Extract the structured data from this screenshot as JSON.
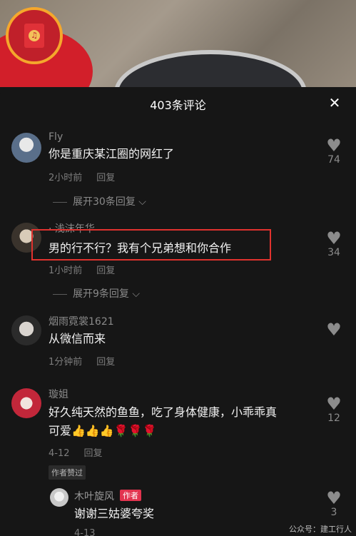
{
  "header": {
    "title": "403条评论",
    "close_icon": "close-icon"
  },
  "comments": [
    {
      "name": "Fly",
      "text": "你是重庆某江圈的网红了",
      "time": "2小时前",
      "reply": "回复",
      "expand": "展开30条回复",
      "likes": "74"
    },
    {
      "name": "· 浅沫年华",
      "text": "男的行不行？我有个兄弟想和你合作",
      "time": "1小时前",
      "reply": "回复",
      "expand": "展开9条回复",
      "likes": "34"
    },
    {
      "name": "烟雨霓裳1621",
      "text": "从微信而来",
      "time": "1分钟前",
      "reply": "回复",
      "likes": ""
    },
    {
      "name": "璇姐",
      "text_line1": "好久纯天然的鱼鱼，吃了身体健康，小乖乖真",
      "text_line2": "可爱👍👍👍🌹🌹🌹",
      "time": "4-12",
      "reply": "回复",
      "badge": "作者赞过",
      "likes": "12"
    }
  ],
  "sub_reply": {
    "name": "木叶旋风",
    "author_tag": "作者",
    "text": "谢谢三姑婆夸奖",
    "time": "4-13",
    "likes": "3"
  },
  "watermark": "公众号：建工行人"
}
